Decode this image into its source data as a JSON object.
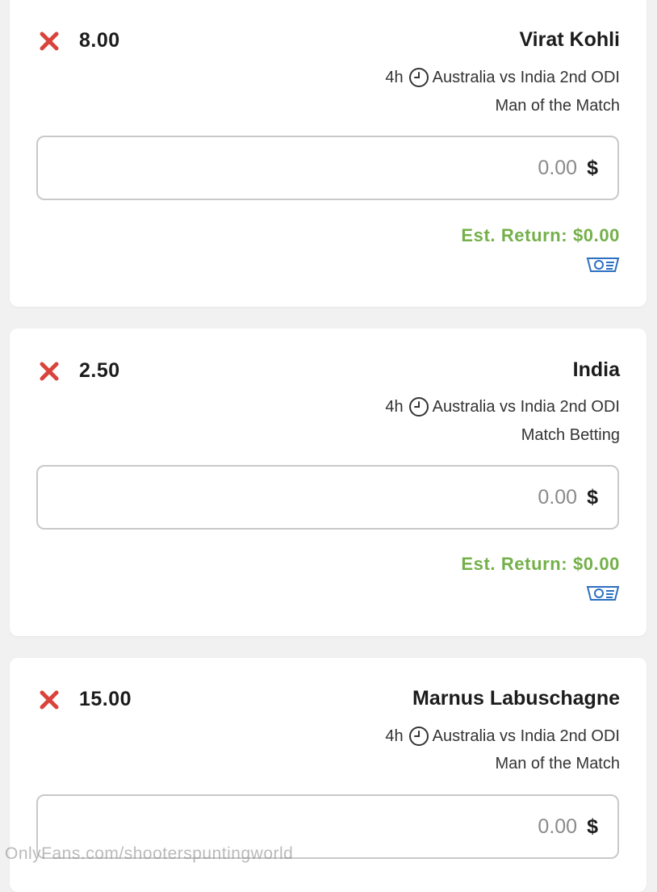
{
  "bets": [
    {
      "selection": "Virat Kohli",
      "odds": "8.00",
      "event": "Australia vs India 2nd ODI",
      "time": "4h",
      "market": "Man of the Match",
      "stake_placeholder": "0.00",
      "currency": "$",
      "est_return": "Est. Return: $0.00"
    },
    {
      "selection": "India",
      "odds": "2.50",
      "event": "Australia vs India 2nd ODI",
      "time": "4h",
      "market": "Match Betting",
      "stake_placeholder": "0.00",
      "currency": "$",
      "est_return": "Est. Return: $0.00"
    },
    {
      "selection": "Marnus Labuschagne",
      "odds": "15.00",
      "event": "Australia vs India 2nd ODI",
      "time": "4h",
      "market": "Man of the Match",
      "stake_placeholder": "0.00",
      "currency": "$"
    }
  ],
  "watermark": "OnlyFans.com/shooterspuntingworld",
  "icons": {
    "remove": "close-x-icon",
    "clock": "clock-icon",
    "bet_type": "cash-ticket-icon"
  },
  "colors": {
    "remove": "#d9433b",
    "est_return": "#74b04a",
    "bet_icon": "#2d6fc1"
  }
}
